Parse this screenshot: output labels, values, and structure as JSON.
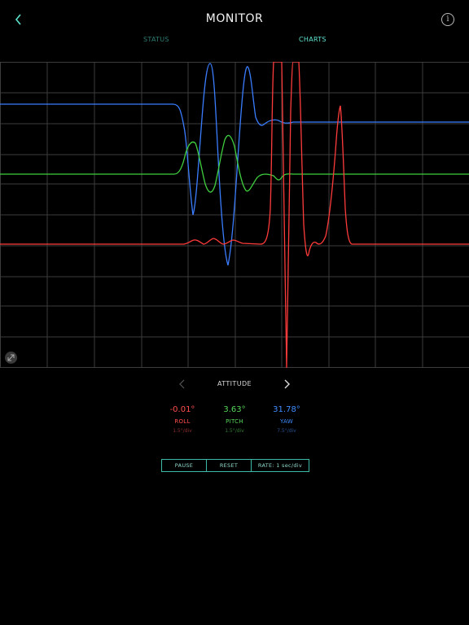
{
  "header": {
    "title": "MONITOR"
  },
  "tabs": [
    {
      "label": "STATUS"
    },
    {
      "label": "CHARTS"
    }
  ],
  "selector": {
    "label": "ATTITUDE"
  },
  "readouts": [
    {
      "value": "-0.01°",
      "label": "ROLL",
      "scale": "1.5°/div",
      "color": "#ff4d4d"
    },
    {
      "value": "3.63°",
      "label": "PITCH",
      "scale": "1.5°/div",
      "color": "#55d65a"
    },
    {
      "value": "31.78°",
      "label": "YAW",
      "scale": "7.5°/div",
      "color": "#3f8cff"
    }
  ],
  "controls": {
    "pause": "PAUSE",
    "reset": "RESET",
    "rate": "RATE: 1 sec/div"
  },
  "colors": {
    "roll": "#ff3b3b",
    "pitch": "#3fcf3f",
    "yaw": "#3a7dff",
    "accent": "#5ee3cf",
    "grid": "#3c3c3c"
  }
}
